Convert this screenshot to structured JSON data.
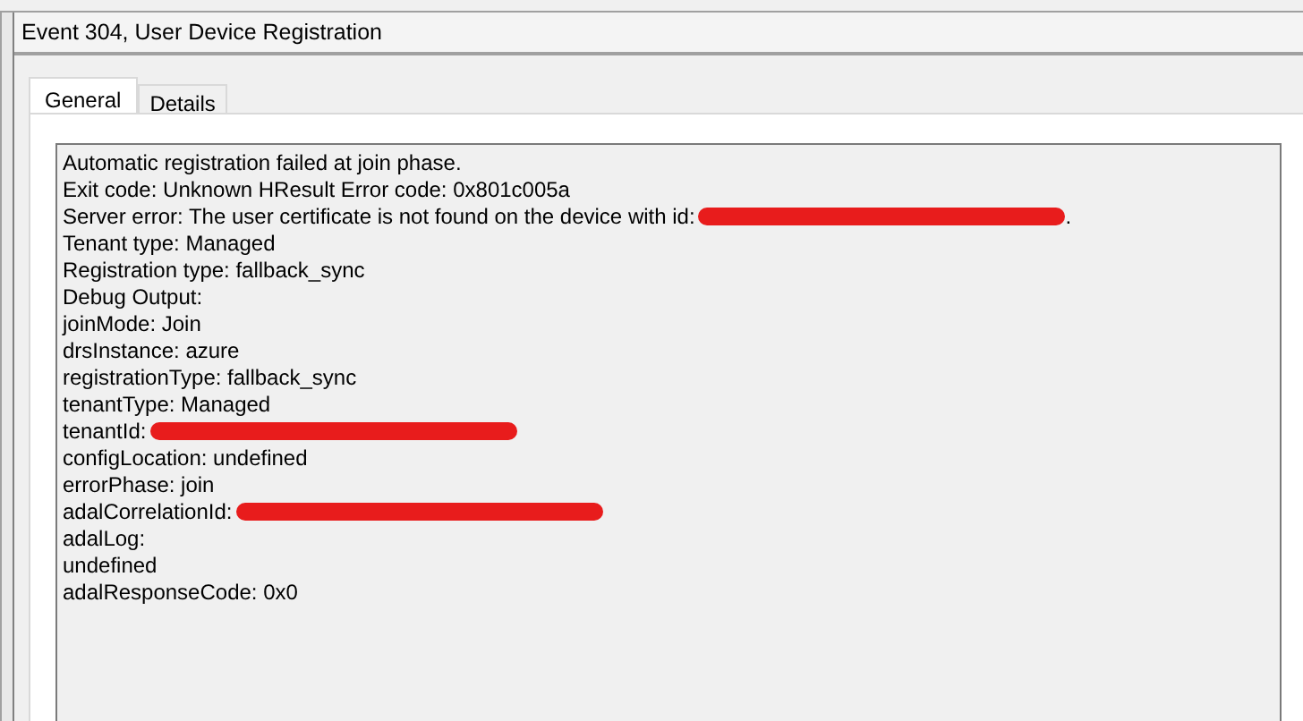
{
  "window": {
    "title": "Event 304, User Device Registration"
  },
  "tabs": [
    {
      "label": "General",
      "selected": true
    },
    {
      "label": "Details",
      "selected": false
    }
  ],
  "description": {
    "lines": [
      {
        "text": "Automatic registration failed at join phase.",
        "redacted": false
      },
      {
        "text": "Exit code: Unknown HResult Error code: 0x801c005a",
        "redacted": false
      },
      {
        "text": "Server error: The user certificate is not found on the device with id:",
        "redacted": true,
        "suffix": "."
      },
      {
        "text": "Tenant type: Managed",
        "redacted": false
      },
      {
        "text": "Registration type: fallback_sync",
        "redacted": false
      },
      {
        "text": "Debug Output:",
        "redacted": false
      },
      {
        "text": "joinMode: Join",
        "redacted": false
      },
      {
        "text": "drsInstance: azure",
        "redacted": false
      },
      {
        "text": "registrationType: fallback_sync",
        "redacted": false
      },
      {
        "text": "tenantType: Managed",
        "redacted": false
      },
      {
        "text": "tenantId:",
        "redacted": true
      },
      {
        "text": "configLocation: undefined",
        "redacted": false
      },
      {
        "text": "errorPhase: join",
        "redacted": false
      },
      {
        "text": "adalCorrelationId:",
        "redacted": true
      },
      {
        "text": "adalLog:",
        "redacted": false
      },
      {
        "text": "undefined",
        "redacted": false
      },
      {
        "text": "adalResponseCode: 0x0",
        "redacted": false
      }
    ]
  }
}
